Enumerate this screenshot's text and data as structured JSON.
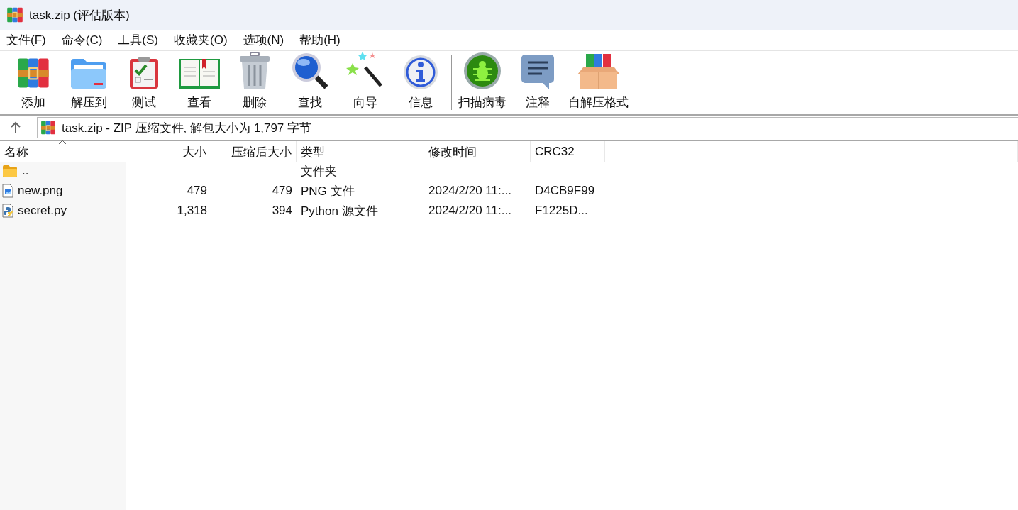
{
  "window": {
    "title": "task.zip (评估版本)"
  },
  "menu": [
    "文件(F)",
    "命令(C)",
    "工具(S)",
    "收藏夹(O)",
    "选项(N)",
    "帮助(H)"
  ],
  "toolbar": {
    "groups": [
      {
        "buttons": [
          {
            "kind": "add",
            "label": "添加"
          },
          {
            "kind": "extract",
            "label": "解压到"
          },
          {
            "kind": "test",
            "label": "测试"
          },
          {
            "kind": "view",
            "label": "查看"
          },
          {
            "kind": "delete",
            "label": "删除"
          },
          {
            "kind": "find",
            "label": "查找"
          },
          {
            "kind": "wizard",
            "label": "向导"
          },
          {
            "kind": "info",
            "label": "信息"
          }
        ]
      },
      {
        "buttons": [
          {
            "kind": "scan",
            "label": "扫描病毒"
          },
          {
            "kind": "comment",
            "label": "注释"
          },
          {
            "kind": "sfx",
            "label": "自解压格式"
          }
        ]
      }
    ]
  },
  "path_bar": {
    "text": "task.zip - ZIP 压缩文件, 解包大小为 1,797 字节"
  },
  "file_list": {
    "columns": [
      {
        "label": "名称",
        "sorted": true
      },
      {
        "label": "大小",
        "sorted": false
      },
      {
        "label": "压缩后大小",
        "sorted": false
      },
      {
        "label": "类型",
        "sorted": false
      },
      {
        "label": "修改时间",
        "sorted": false
      },
      {
        "label": "CRC32",
        "sorted": false
      }
    ],
    "rows": [
      {
        "kind": "folder",
        "name": "..",
        "size": "",
        "packed": "",
        "type": "文件夹",
        "modified": "",
        "crc32": ""
      },
      {
        "kind": "image",
        "name": "new.png",
        "size": "479",
        "packed": "479",
        "type": "PNG 文件",
        "modified": "2024/2/20 11:...",
        "crc32": "D4CB9F99"
      },
      {
        "kind": "python",
        "name": "secret.py",
        "size": "1,318",
        "packed": "394",
        "type": "Python 源文件",
        "modified": "2024/2/20 11:...",
        "crc32": "F1225D..."
      }
    ]
  }
}
